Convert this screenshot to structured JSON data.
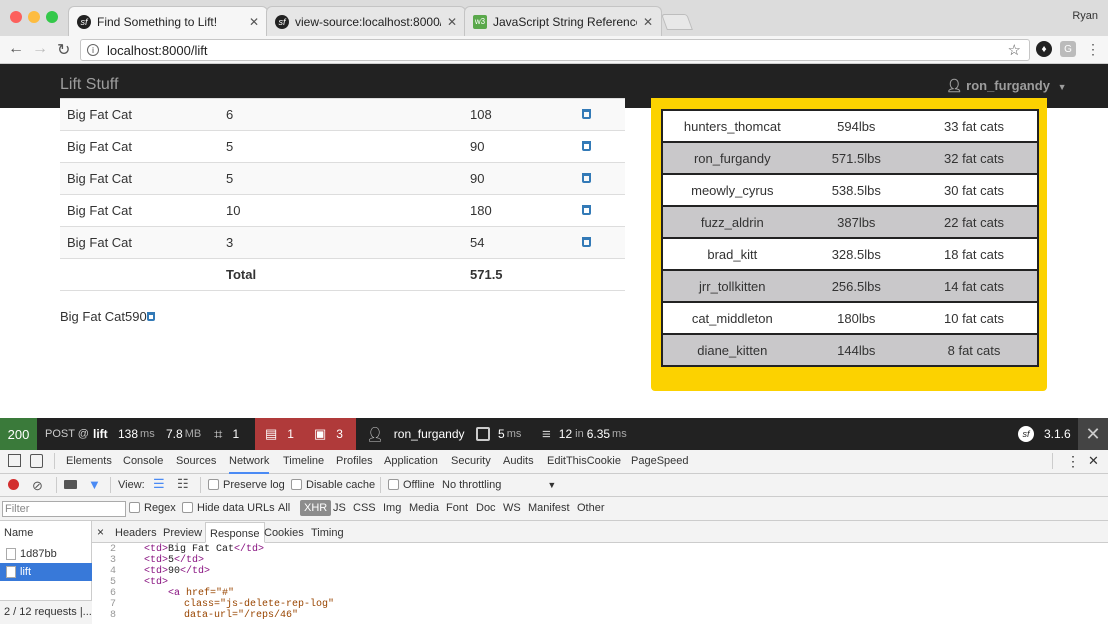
{
  "browser": {
    "profile": "Ryan",
    "tabs": [
      {
        "label": "Find Something to Lift!",
        "favicon": "sf"
      },
      {
        "label": "view-source:localhost:8000/lif",
        "favicon": "sf"
      },
      {
        "label": "JavaScript String Reference",
        "favicon": "w3"
      }
    ],
    "url": "localhost:8000/lift"
  },
  "site": {
    "brand": "Lift Stuff",
    "user": "ron_furgandy"
  },
  "rep_logs": {
    "rows": [
      {
        "item": "Big Fat Cat",
        "reps": "6",
        "weight": "108"
      },
      {
        "item": "Big Fat Cat",
        "reps": "5",
        "weight": "90"
      },
      {
        "item": "Big Fat Cat",
        "reps": "5",
        "weight": "90"
      },
      {
        "item": "Big Fat Cat",
        "reps": "10",
        "weight": "180"
      },
      {
        "item": "Big Fat Cat",
        "reps": "3",
        "weight": "54"
      }
    ],
    "total_label": "Total",
    "total_value": "571.5",
    "new_row_text": "Big Fat Cat590"
  },
  "leaderboard": [
    {
      "user": "hunters_thomcat",
      "weight": "594lbs",
      "cats": "33 fat cats"
    },
    {
      "user": "ron_furgandy",
      "weight": "571.5lbs",
      "cats": "32 fat cats"
    },
    {
      "user": "meowly_cyrus",
      "weight": "538.5lbs",
      "cats": "30 fat cats"
    },
    {
      "user": "fuzz_aldrin",
      "weight": "387lbs",
      "cats": "22 fat cats"
    },
    {
      "user": "brad_kitt",
      "weight": "328.5lbs",
      "cats": "18 fat cats"
    },
    {
      "user": "jrr_tollkitten",
      "weight": "256.5lbs",
      "cats": "14 fat cats"
    },
    {
      "user": "cat_middleton",
      "weight": "180lbs",
      "cats": "10 fat cats"
    },
    {
      "user": "diane_kitten",
      "weight": "144lbs",
      "cats": "8 fat cats"
    }
  ],
  "sf_toolbar": {
    "status": "200",
    "method": "POST @",
    "route": "lift",
    "time": "138",
    "time_unit": "ms",
    "memory": "7.8",
    "memory_unit": "MB",
    "forms": "1",
    "logs": "1",
    "errors": "3",
    "user": "ron_furgandy",
    "twig_time": "5",
    "twig_unit": "ms",
    "db_queries": "12",
    "db_in": "in",
    "db_time": "6.35",
    "db_unit": "ms",
    "version": "3.1.6"
  },
  "devtools": {
    "tabs": [
      "Elements",
      "Console",
      "Sources",
      "Network",
      "Timeline",
      "Profiles",
      "Application",
      "Security",
      "Audits",
      "EditThisCookie",
      "PageSpeed"
    ],
    "active_tab": "Network",
    "net": {
      "view_label": "View:",
      "preserve_log": "Preserve log",
      "disable_cache": "Disable cache",
      "offline": "Offline",
      "throttling": "No throttling"
    },
    "filter": {
      "placeholder": "Filter",
      "regex": "Regex",
      "hide_data_urls": "Hide data URLs",
      "types": [
        "All",
        "XHR",
        "JS",
        "CSS",
        "Img",
        "Media",
        "Font",
        "Doc",
        "WS",
        "Manifest",
        "Other"
      ]
    },
    "requests": {
      "header": "Name",
      "items": [
        "1d87bb",
        "lift"
      ],
      "summary": "2 / 12 requests |..."
    },
    "subtabs": [
      "Headers",
      "Preview",
      "Response",
      "Cookies",
      "Timing"
    ],
    "code": [
      {
        "n": "2",
        "t": "<td>",
        "x": "Big Fat Cat",
        "c": "</td>"
      },
      {
        "n": "3",
        "t": "<td>",
        "x": "5",
        "c": "</td>"
      },
      {
        "n": "4",
        "t": "<td>",
        "x": "90",
        "c": "</td>"
      },
      {
        "n": "5",
        "t": "<td>",
        "x": "",
        "c": ""
      },
      {
        "n": "6",
        "t": "<a ",
        "x": "href=\"#\"",
        "c": ""
      },
      {
        "n": "7",
        "t": "",
        "x": "class=\"js-delete-rep-log\"",
        "c": ""
      },
      {
        "n": "8",
        "t": "",
        "x": "data-url=\"/reps/46\"",
        "c": ""
      }
    ]
  },
  "colors": {
    "navbar": "#222222",
    "leaderboard_bg": "#fcd200",
    "arrow": "#ff8c00",
    "sf_status_ok": "#3a7a3a",
    "sf_error": "#b03a3a",
    "link": "#337ab7"
  }
}
